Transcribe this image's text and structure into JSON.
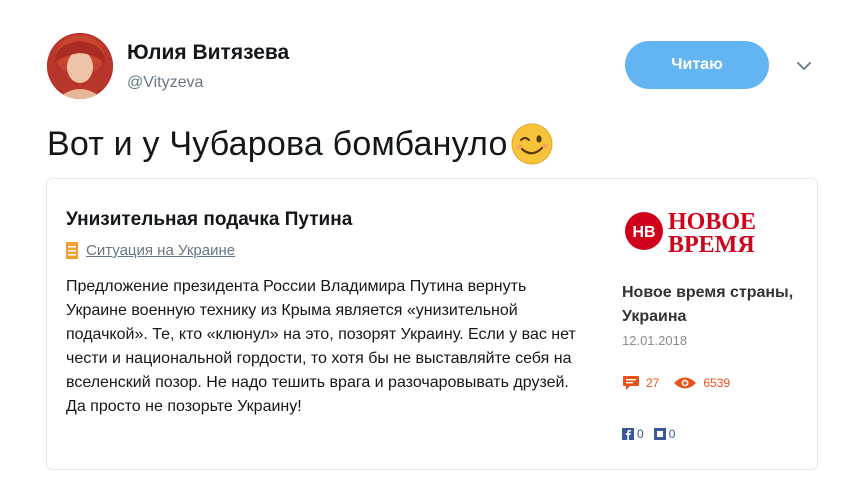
{
  "author": {
    "name": "Юлия Витязева",
    "handle": "@Vityzeva"
  },
  "follow_button_label": "Читаю",
  "tweet": {
    "text": "Вот и у Чубарова бомбануло",
    "emoji": "winking-face"
  },
  "card": {
    "title": "Унизительная подачка Путина",
    "category": "Ситуация на Украине",
    "body": "Предложение президента России Владимира Путина вернуть Украине военную технику из Крыма является «унизительной подачкой». Те, кто «клюнул» на это, позорят Украину. Если у вас нет чести и национальной гордости, то хотя бы не выставляйте себя на вселенский позор. Не надо тешить врага и разочаровывать друзей. Да просто не позорьте Украину!",
    "source": {
      "logo_text_line1": "НОВОЕ",
      "logo_text_line2": "ВРЕМЯ",
      "logo_badge": "НВ",
      "name": "Новое время страны, Украина",
      "date": "12.01.2018"
    },
    "stats": {
      "comments": "27",
      "views": "6539"
    },
    "shares": {
      "facebook": "0",
      "other": "0"
    }
  },
  "colors": {
    "follow_button": "#62b5f2",
    "brand_red": "#d0021b",
    "stat_orange": "#e5531a",
    "facebook_blue": "#3b5998"
  }
}
